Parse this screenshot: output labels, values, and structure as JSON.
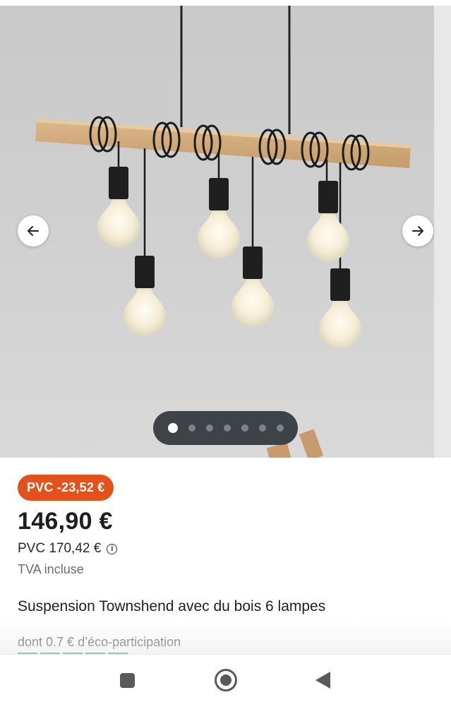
{
  "gallery": {
    "prev_icon": "arrow-left-icon",
    "next_icon": "arrow-right-icon",
    "slide_count": 7,
    "active_slide": 1
  },
  "product": {
    "discount_badge": "PVC -23,52 €",
    "price": "146,90 €",
    "old_price": "PVC 170,42 €",
    "info_icon": "info-icon",
    "tax_note": "TVA incluse",
    "title": "Suspension Townshend avec du bois 6 lampes",
    "eco_participation": "dont 0.7 € d’éco-participation"
  },
  "colors": {
    "badge": "#e4521b",
    "eco_bar": "#1ea46e",
    "dots_bg": "#3e4347"
  },
  "system_nav": {
    "recent_icon": "square-icon",
    "home_icon": "circle-home-icon",
    "back_icon": "triangle-back-icon"
  }
}
